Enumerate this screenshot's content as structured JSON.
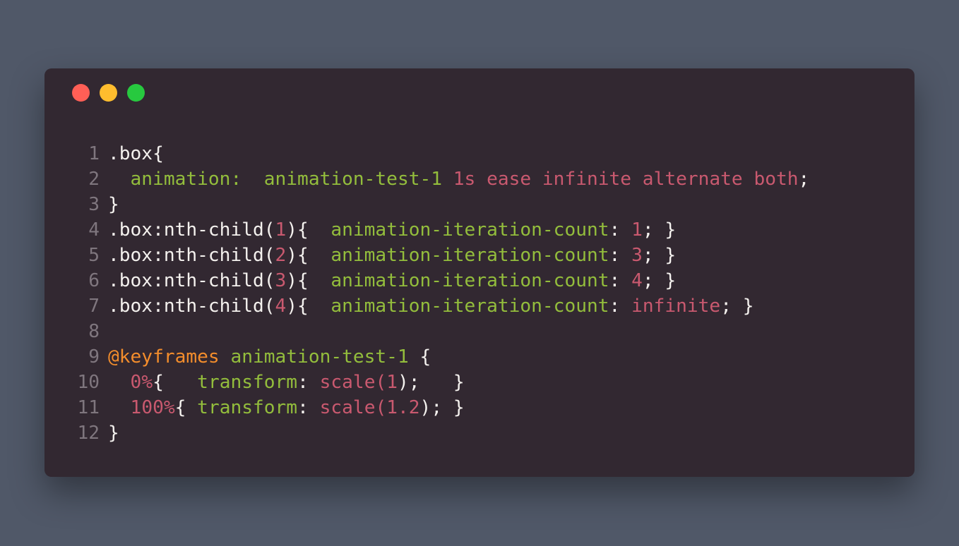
{
  "window": {
    "controls": [
      {
        "name": "close",
        "color": "#ff5f56"
      },
      {
        "name": "minimize",
        "color": "#ffbd2e"
      },
      {
        "name": "maximize",
        "color": "#27c93f"
      }
    ]
  },
  "colors": {
    "background": "#505868",
    "panel": "#322831",
    "plain": "#f4f1ee",
    "property": "#93bd3c",
    "number": "#c9596f",
    "keyword": "#f38d2c",
    "line_number": "#7f767e"
  },
  "code_lines": [
    {
      "number": "1",
      "tokens": [
        {
          "t": ".box{",
          "k": "plain"
        }
      ]
    },
    {
      "number": "2",
      "tokens": [
        {
          "t": "  animation",
          "k": "prop"
        },
        {
          "t": ":  ",
          "k": "prop"
        },
        {
          "t": "animation-test-1",
          "k": "prop"
        },
        {
          "t": " 1s ease infinite alternate both",
          "k": "num"
        },
        {
          "t": ";",
          "k": "plain"
        }
      ]
    },
    {
      "number": "3",
      "tokens": [
        {
          "t": "}",
          "k": "plain"
        }
      ]
    },
    {
      "number": "4",
      "tokens": [
        {
          "t": ".box:nth-child(",
          "k": "plain"
        },
        {
          "t": "1",
          "k": "num"
        },
        {
          "t": "){  ",
          "k": "plain"
        },
        {
          "t": "animation-iteration-count",
          "k": "prop"
        },
        {
          "t": ": ",
          "k": "plain"
        },
        {
          "t": "1",
          "k": "num"
        },
        {
          "t": "; }",
          "k": "plain"
        }
      ]
    },
    {
      "number": "5",
      "tokens": [
        {
          "t": ".box:nth-child(",
          "k": "plain"
        },
        {
          "t": "2",
          "k": "num"
        },
        {
          "t": "){  ",
          "k": "plain"
        },
        {
          "t": "animation-iteration-count",
          "k": "prop"
        },
        {
          "t": ": ",
          "k": "plain"
        },
        {
          "t": "3",
          "k": "num"
        },
        {
          "t": "; }",
          "k": "plain"
        }
      ]
    },
    {
      "number": "6",
      "tokens": [
        {
          "t": ".box:nth-child(",
          "k": "plain"
        },
        {
          "t": "3",
          "k": "num"
        },
        {
          "t": "){  ",
          "k": "plain"
        },
        {
          "t": "animation-iteration-count",
          "k": "prop"
        },
        {
          "t": ": ",
          "k": "plain"
        },
        {
          "t": "4",
          "k": "num"
        },
        {
          "t": "; }",
          "k": "plain"
        }
      ]
    },
    {
      "number": "7",
      "tokens": [
        {
          "t": ".box:nth-child(",
          "k": "plain"
        },
        {
          "t": "4",
          "k": "num"
        },
        {
          "t": "){  ",
          "k": "plain"
        },
        {
          "t": "animation-iteration-count",
          "k": "prop"
        },
        {
          "t": ": ",
          "k": "plain"
        },
        {
          "t": "infinite",
          "k": "num"
        },
        {
          "t": "; }",
          "k": "plain"
        }
      ]
    },
    {
      "number": "8",
      "tokens": []
    },
    {
      "number": "9",
      "tokens": [
        {
          "t": "@keyframes",
          "k": "kw"
        },
        {
          "t": " ",
          "k": "plain"
        },
        {
          "t": "animation-test-1",
          "k": "prop"
        },
        {
          "t": " {",
          "k": "plain"
        }
      ]
    },
    {
      "number": "10",
      "tokens": [
        {
          "t": "  ",
          "k": "plain"
        },
        {
          "t": "0%",
          "k": "num"
        },
        {
          "t": "{   ",
          "k": "plain"
        },
        {
          "t": "transform",
          "k": "prop"
        },
        {
          "t": ": ",
          "k": "plain"
        },
        {
          "t": "scale(",
          "k": "num"
        },
        {
          "t": "1",
          "k": "num"
        },
        {
          "t": ");   }",
          "k": "plain"
        }
      ]
    },
    {
      "number": "11",
      "tokens": [
        {
          "t": "  ",
          "k": "plain"
        },
        {
          "t": "100%",
          "k": "num"
        },
        {
          "t": "{ ",
          "k": "plain"
        },
        {
          "t": "transform",
          "k": "prop"
        },
        {
          "t": ": ",
          "k": "plain"
        },
        {
          "t": "scale(",
          "k": "num"
        },
        {
          "t": "1.2",
          "k": "num"
        },
        {
          "t": "); }",
          "k": "plain"
        }
      ]
    },
    {
      "number": "12",
      "tokens": [
        {
          "t": "}",
          "k": "plain"
        }
      ]
    }
  ]
}
